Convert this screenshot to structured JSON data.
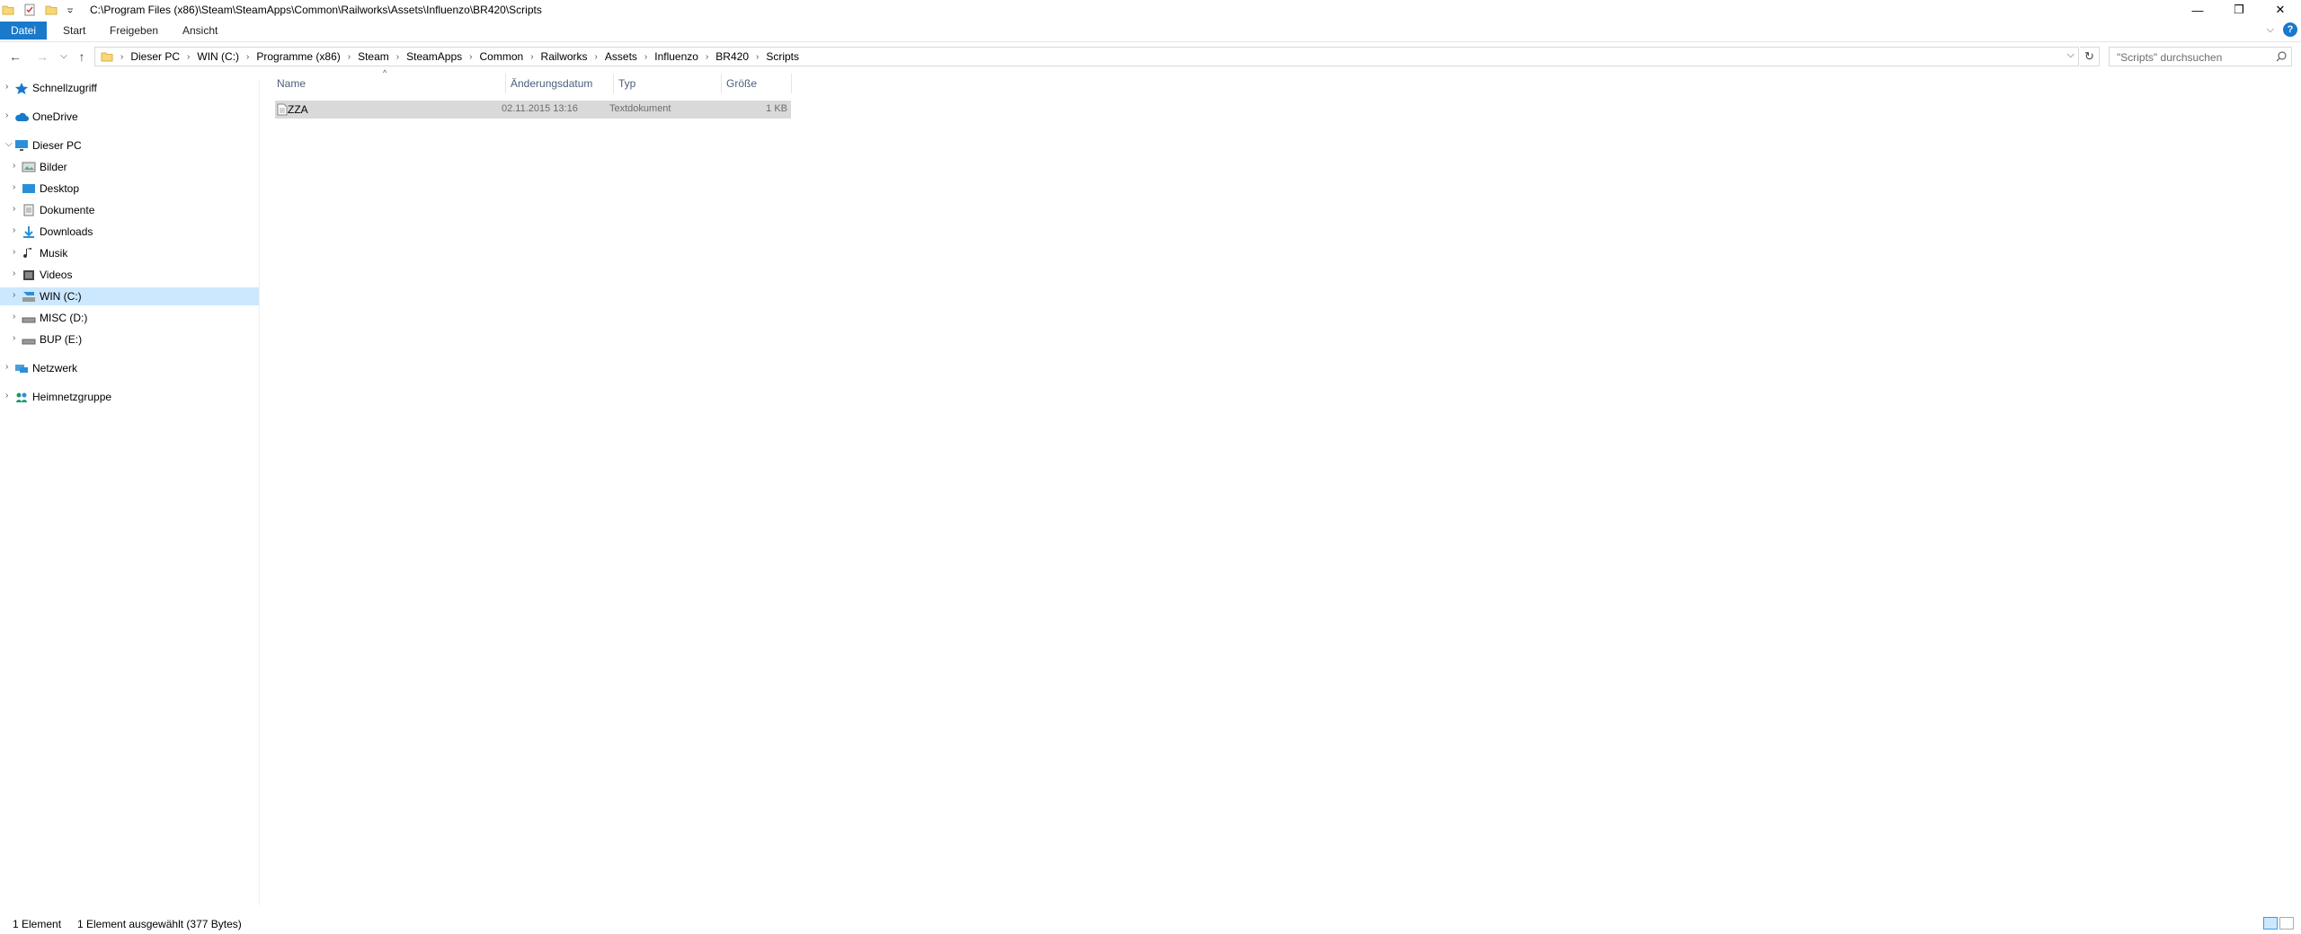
{
  "window": {
    "title_path": "C:\\Program Files (x86)\\Steam\\SteamApps\\Common\\Railworks\\Assets\\Influenzo\\BR420\\Scripts",
    "minimize": "—",
    "restore": "❐",
    "close": "✕"
  },
  "ribbon": {
    "tabs": [
      "Datei",
      "Start",
      "Freigeben",
      "Ansicht"
    ],
    "expand": "⌵",
    "help": "?"
  },
  "nav": {
    "back": "←",
    "forward": "→",
    "recent": "⌵",
    "up": "↑",
    "breadcrumb": [
      "Dieser PC",
      "WIN (C:)",
      "Programme (x86)",
      "Steam",
      "SteamApps",
      "Common",
      "Railworks",
      "Assets",
      "Influenzo",
      "BR420",
      "Scripts"
    ],
    "refresh": "↻",
    "search_placeholder": "\"Scripts\" durchsuchen"
  },
  "tree": [
    {
      "label": "Schnellzugriff",
      "icon": "star-icon",
      "color": "#1979ca"
    },
    {
      "label": "OneDrive",
      "icon": "cloud-icon",
      "color": "#1979ca"
    },
    {
      "label": "Dieser PC",
      "icon": "computer-icon",
      "color": "#2b8fd8"
    },
    {
      "label": "Bilder",
      "icon": "pictures-icon"
    },
    {
      "label": "Desktop",
      "icon": "desktop-icon",
      "color": "#2b8fd8"
    },
    {
      "label": "Dokumente",
      "icon": "documents-icon"
    },
    {
      "label": "Downloads",
      "icon": "download-icon",
      "color": "#2b8fd8"
    },
    {
      "label": "Musik",
      "icon": "music-icon"
    },
    {
      "label": "Videos",
      "icon": "video-icon"
    },
    {
      "label": "WIN (C:)",
      "icon": "drive-c-icon"
    },
    {
      "label": "MISC (D:)",
      "icon": "drive-icon"
    },
    {
      "label": "BUP (E:)",
      "icon": "drive-icon"
    },
    {
      "label": "Netzwerk",
      "icon": "network-icon"
    },
    {
      "label": "Heimnetzgruppe",
      "icon": "homegroup-icon",
      "color": "#1a9a6c"
    }
  ],
  "columns": {
    "name": "Name",
    "date": "Änderungsdatum",
    "type": "Typ",
    "size": "Größe",
    "sort_arrow": "^"
  },
  "files": [
    {
      "name": "ZZA",
      "date": "02.11.2015 13:16",
      "type": "Textdokument",
      "size": "1 KB"
    }
  ],
  "status": {
    "count": "1 Element",
    "selected": "1 Element ausgewählt (377 Bytes)"
  },
  "colors": {
    "accent": "#1979ca",
    "selection": "#cce8ff",
    "file_selection": "#d9d9d9"
  }
}
